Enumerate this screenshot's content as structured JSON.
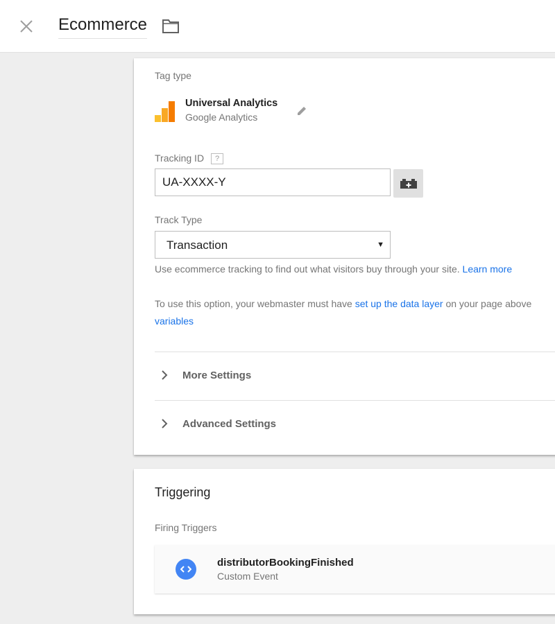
{
  "header": {
    "title": "Ecommerce",
    "close_icon": "close-icon",
    "folder_icon": "folder-icon"
  },
  "tag_config": {
    "tag_type_label": "Tag type",
    "tag_name": "Universal Analytics",
    "tag_vendor": "Google Analytics",
    "tracking_id_label": "Tracking ID",
    "tracking_id_help": "?",
    "tracking_id_value": "UA-XXXX-Y",
    "track_type_label": "Track Type",
    "track_type_value": "Transaction",
    "help_line": "Use ecommerce tracking to find out what visitors buy through your site.",
    "learn_more": "Learn more",
    "webmaster_prefix": "To use this option, your webmaster must have",
    "data_layer_link": "set up the data layer",
    "webmaster_suffix": "on your page above",
    "variables_link": "variables",
    "more_settings": "More Settings",
    "advanced_settings": "Advanced Settings"
  },
  "triggering": {
    "title": "Triggering",
    "firing_label": "Firing Triggers",
    "trigger_name": "distributorBookingFinished",
    "trigger_type": "Custom Event"
  },
  "colors": {
    "link": "#1a73e8",
    "trigger_icon": "#4285f4",
    "ga_orange": "#f57c00",
    "ga_yellow": "#fbc02d",
    "background": "#eeeeee"
  }
}
